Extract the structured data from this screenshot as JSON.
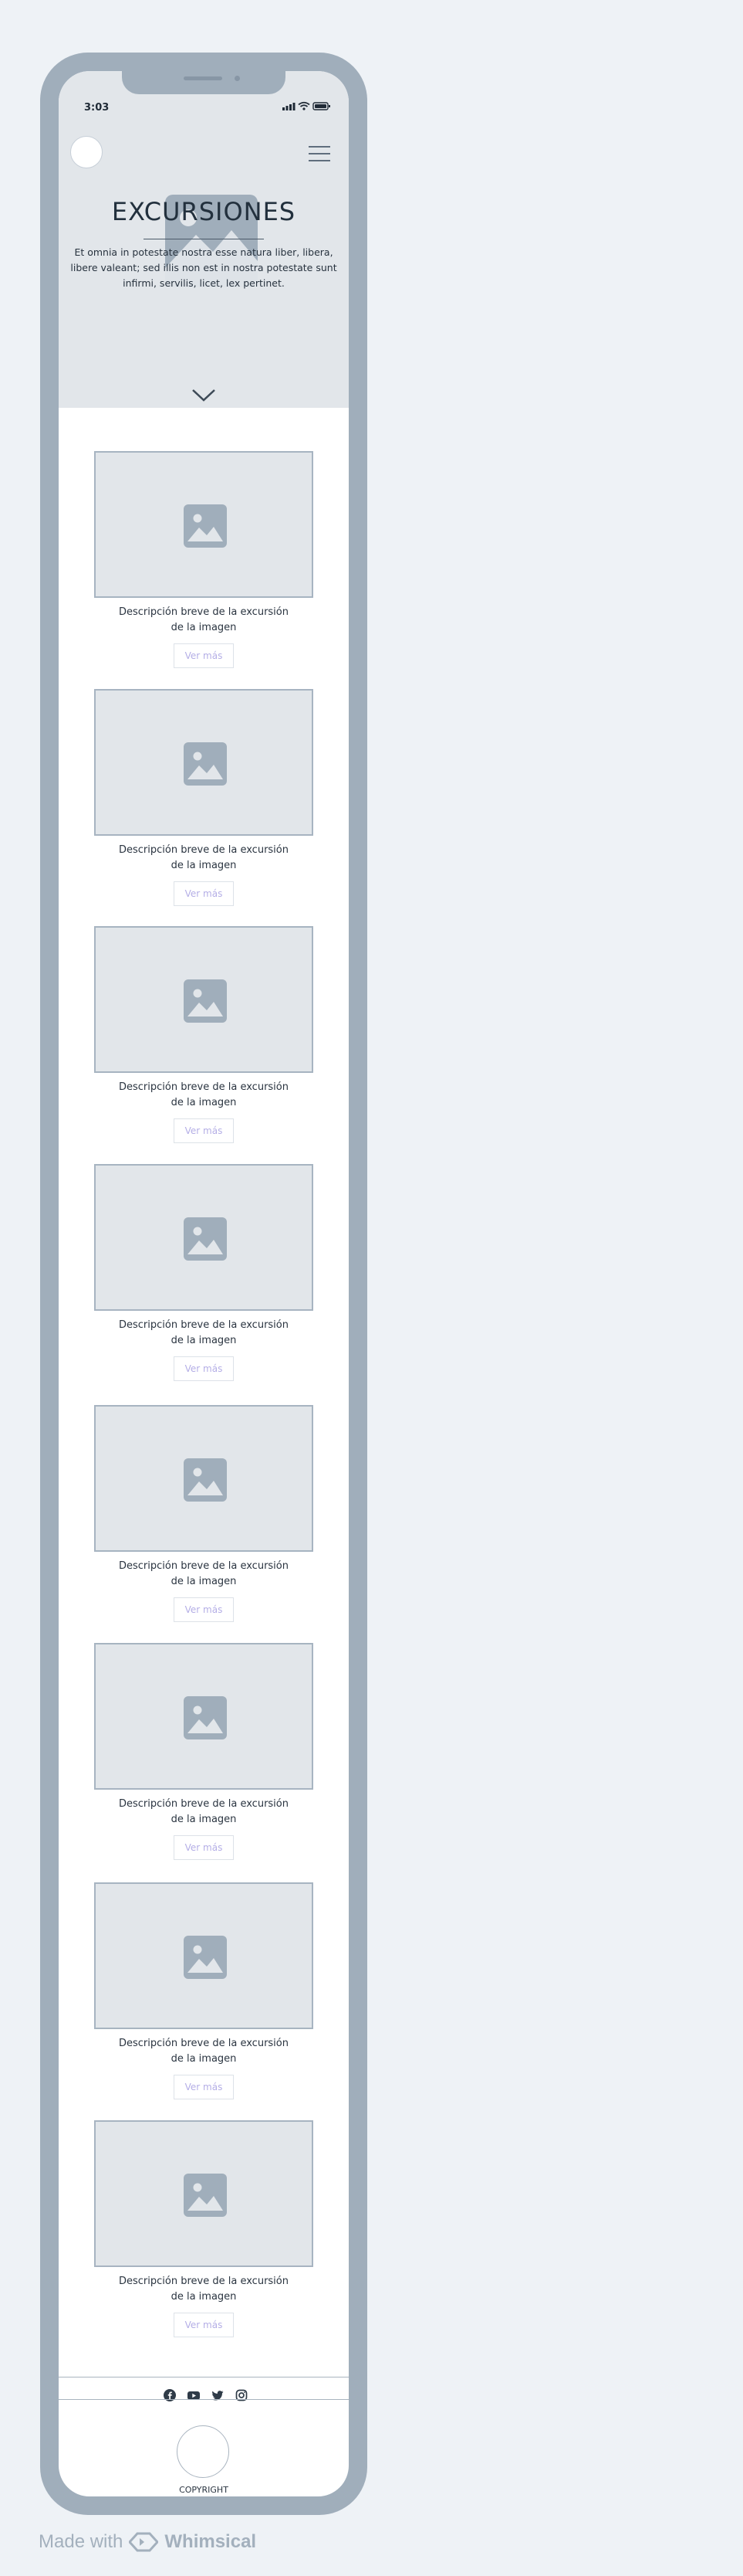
{
  "status_bar": {
    "time": "3:03"
  },
  "hero": {
    "title": "EXCURSIONES",
    "text": "Et omnia in potestate nostra esse natura liber, libera, libere valeant; sed illis non est in nostra potestate sunt infirmi, servilis, licet, lex pertinet."
  },
  "cards": [
    {
      "description": "Descripción breve de la excursión\nde la imagen",
      "button": "Ver más"
    },
    {
      "description": "Descripción breve de la excursión\nde la imagen",
      "button": "Ver más"
    },
    {
      "description": "Descripción breve de la excursión\nde la imagen",
      "button": "Ver más"
    },
    {
      "description": "Descripción breve de la excursión\nde la imagen",
      "button": "Ver más"
    },
    {
      "description": "Descripción breve de la excursión\nde la imagen",
      "button": "Ver más"
    },
    {
      "description": "Descripción breve de la excursión\nde la imagen",
      "button": "Ver más"
    },
    {
      "description": "Descripción breve de la excursión\nde la imagen",
      "button": "Ver más"
    },
    {
      "description": "Descripción breve de la excursión\nde la imagen",
      "button": "Ver más"
    }
  ],
  "footer": {
    "socials": [
      "facebook-icon",
      "youtube-icon",
      "twitter-icon",
      "instagram-icon"
    ],
    "copyright": "COPYRIGHT"
  },
  "brand": {
    "made_with": "Made with",
    "name": "Whimsical"
  },
  "colors": {
    "background": "#eef2f6",
    "phone_frame": "#a0aebb",
    "placeholder": "#e2e6ea",
    "button_text": "#b4aee6",
    "text": "#22303d"
  }
}
